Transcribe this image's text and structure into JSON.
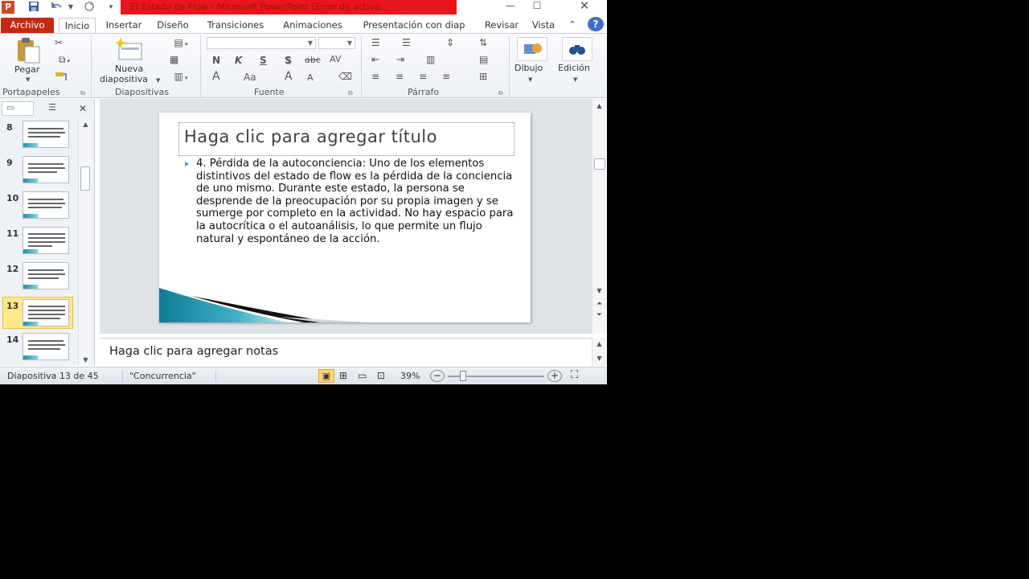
{
  "titlebar": {
    "app_logo": "P",
    "doc_title": "El Estado de Flow  -  Microsoft PowerPoint (Error de activa...",
    "icons": [
      "save-icon",
      "undo-icon",
      "redo-icon",
      "customize-qat-icon",
      "minimize-icon",
      "maximize-icon",
      "close-icon"
    ]
  },
  "ribbon_tabs": [
    "Archivo",
    "Inicio",
    "Insertar",
    "Diseño",
    "Transiciones",
    "Animaciones",
    "Presentación con diap",
    "Revisar",
    "Vista"
  ],
  "active_tab": "Inicio",
  "ribbon": {
    "portapapeles": {
      "label": "Portapapeles",
      "paste_label": "Pegar"
    },
    "diapositivas": {
      "label": "Diapositivas",
      "new_slide_line1": "Nueva",
      "new_slide_line2": "diapositiva"
    },
    "fuente": {
      "label": "Fuente",
      "bold": "N",
      "italic": "K",
      "underline": "S",
      "shadow": "S",
      "strike": "abc",
      "spacing": "AV",
      "font_color": "A",
      "change_case": "Aa",
      "grow": "A",
      "shrink": "A"
    },
    "parrafo": {
      "label": "Párrafo"
    },
    "dibujo": {
      "label": "Dibujo"
    },
    "edicion": {
      "label": "Edición"
    }
  },
  "thumbnails": [
    {
      "num": "8"
    },
    {
      "num": "9"
    },
    {
      "num": "10"
    },
    {
      "num": "11"
    },
    {
      "num": "12"
    },
    {
      "num": "13"
    },
    {
      "num": "14"
    }
  ],
  "selected_slide": "13",
  "slide": {
    "title_placeholder": "Haga clic para agregar título",
    "body": "4. Pérdida de la autoconciencia: Uno de los elementos distintivos del estado de flow es la pérdida de la conciencia de uno mismo. Durante este estado, la persona se desprende de la preocupación por su propia imagen y se sumerge por completo en la actividad. No hay espacio para la autocrítica o el autoanálisis, lo que permite un flujo natural y espontáneo de la acción."
  },
  "notes_placeholder": "Haga clic para agregar notas",
  "status": {
    "slide_info": "Diapositiva 13 de 45",
    "theme": "\"Concurrencia\"",
    "zoom": "39%",
    "zoom_level_percent": 39
  },
  "colors": {
    "archivo_tab": "#c4290f",
    "title_highlight": "#e8151a",
    "accent_teal": "#1d8fa8",
    "selected_thumb": "#fde88a"
  }
}
